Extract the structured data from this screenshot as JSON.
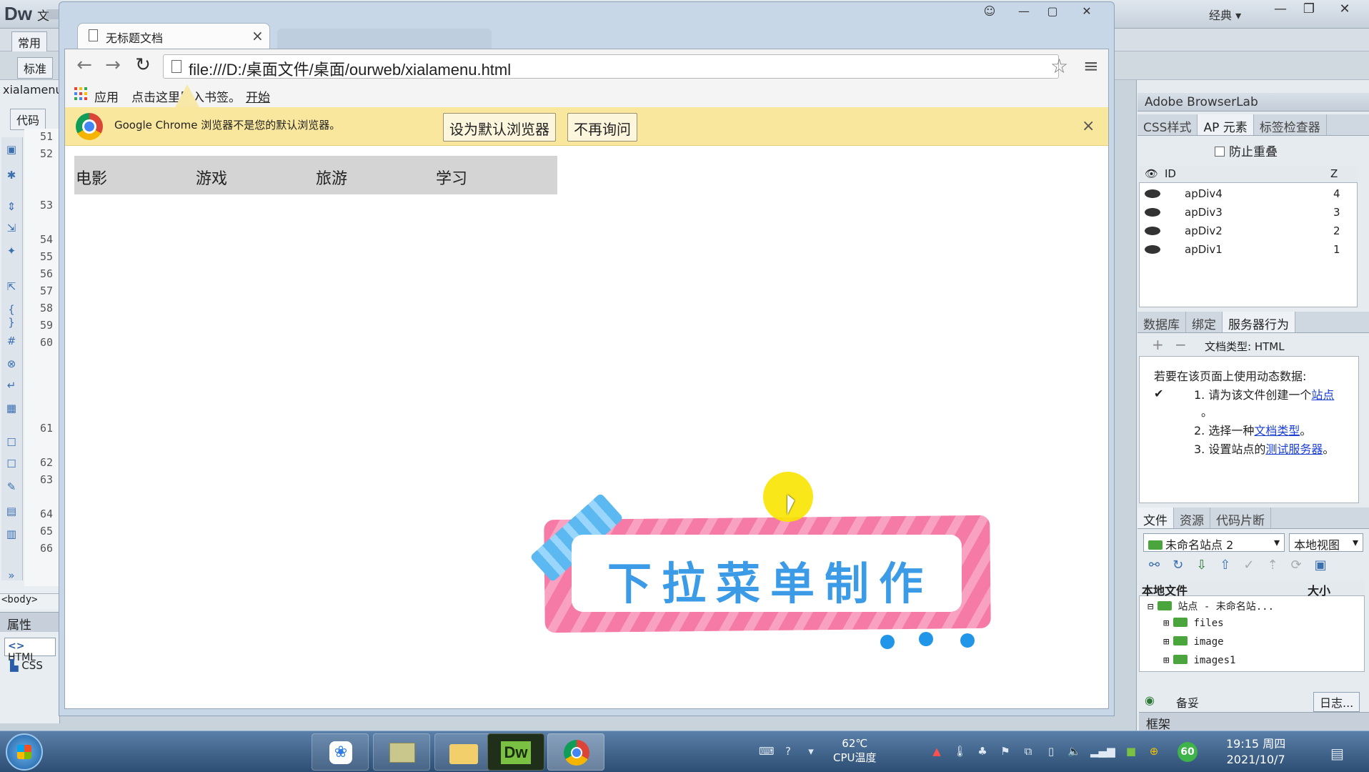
{
  "dreamweaver": {
    "logo": "Dw",
    "menu_first": "文",
    "workspace": "经典",
    "common_tab": "常用",
    "standard_tab": "标准",
    "filename": "xialamenu",
    "code_tab": "代码",
    "line_numbers": [
      "51",
      "52",
      "53",
      "54",
      "55",
      "56",
      "57",
      "58",
      "59",
      "60",
      "61",
      "62",
      "63",
      "64",
      "65",
      "66"
    ],
    "body_tag": "<body>",
    "properties_title": "属性",
    "props_html": "HTML",
    "props_css": "CSS",
    "right_panel": {
      "browserlab": "Adobe BrowserLab",
      "tabs1": [
        "CSS样式",
        "AP 元素",
        "标签检查器"
      ],
      "prevent_overlap": "防止重叠",
      "ap_header_id": "ID",
      "ap_header_z": "Z",
      "ap_rows": [
        {
          "id": "apDiv4",
          "z": "4"
        },
        {
          "id": "apDiv3",
          "z": "3"
        },
        {
          "id": "apDiv2",
          "z": "2"
        },
        {
          "id": "apDiv1",
          "z": "1"
        }
      ],
      "tabs2": [
        "数据库",
        "绑定",
        "服务器行为"
      ],
      "doc_type_label": "文档类型: HTML",
      "server_intro": "若要在该页面上使用动态数据:",
      "server_steps": [
        {
          "text": "1. 请为该文件创建一个",
          "link": "站点",
          "tail": "。"
        },
        {
          "text": "2. 选择一种",
          "link": "文档类型",
          "tail": "。"
        },
        {
          "text": "3. 设置站点的",
          "link": "测试服务器",
          "tail": "。"
        }
      ],
      "tabs3": [
        "文件",
        "资源",
        "代码片断"
      ],
      "site_select": "未命名站点 2",
      "view_select": "本地视图",
      "files_header": "本地文件",
      "files_size": "大小",
      "tree": [
        {
          "label": "站点 - 未命名站...",
          "expanded": true
        },
        {
          "label": "files"
        },
        {
          "label": "image"
        },
        {
          "label": "images1"
        }
      ],
      "beian": "备妥",
      "log_button": "日志...",
      "frame": "框架"
    }
  },
  "chrome": {
    "tab_title": "无标题文档",
    "url": "file:///D:/桌面文件/桌面/ourweb/xialamenu.html",
    "bookmarks": {
      "apps": "应用",
      "hint": "点击这里导入书签。",
      "start": "开始"
    },
    "infobar": {
      "text": "Google Chrome 浏览器不是您的默认浏览器。",
      "set_default": "设为默认浏览器",
      "dont_ask": "不再询问"
    }
  },
  "page": {
    "menu_items": [
      "电影",
      "游戏",
      "旅游",
      "学习"
    ]
  },
  "overlay": {
    "title": "下拉菜单制作"
  },
  "taskbar": {
    "temp": "62℃",
    "temp_label": "CPU温度",
    "tray_badge": "60",
    "time": "19:15 周四",
    "date": "2021/10/7"
  },
  "colors": {
    "infobar": "#f9e79d",
    "menu_bar": "#d4d4d4",
    "sticker_pink": "#f57aa6",
    "sticker_blue": "#3b9be6",
    "link": "#1a3fd1"
  }
}
